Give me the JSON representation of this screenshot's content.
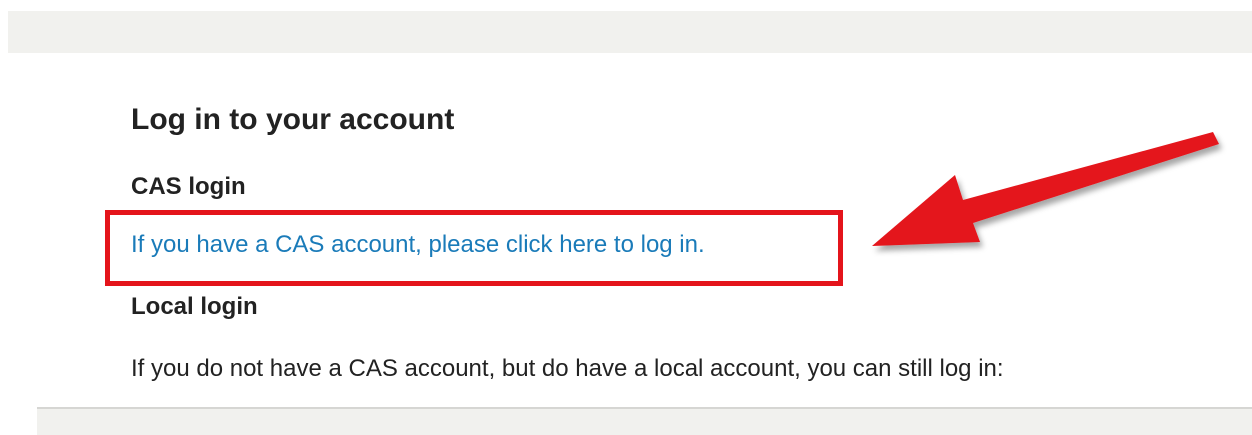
{
  "login": {
    "title": "Log in to your account",
    "cas_heading": "CAS login",
    "cas_link": "If you have a CAS account, please click here to log in.",
    "local_heading": "Local login",
    "local_text": "If you do not have a CAS account, but do have a local account, you can still log in:"
  },
  "annotation": {
    "color": "#e4141b",
    "arrow_icon": "red-arrow-icon"
  },
  "colors": {
    "link": "#1a7bb9",
    "text": "#222222",
    "band": "#f1f1ee"
  }
}
